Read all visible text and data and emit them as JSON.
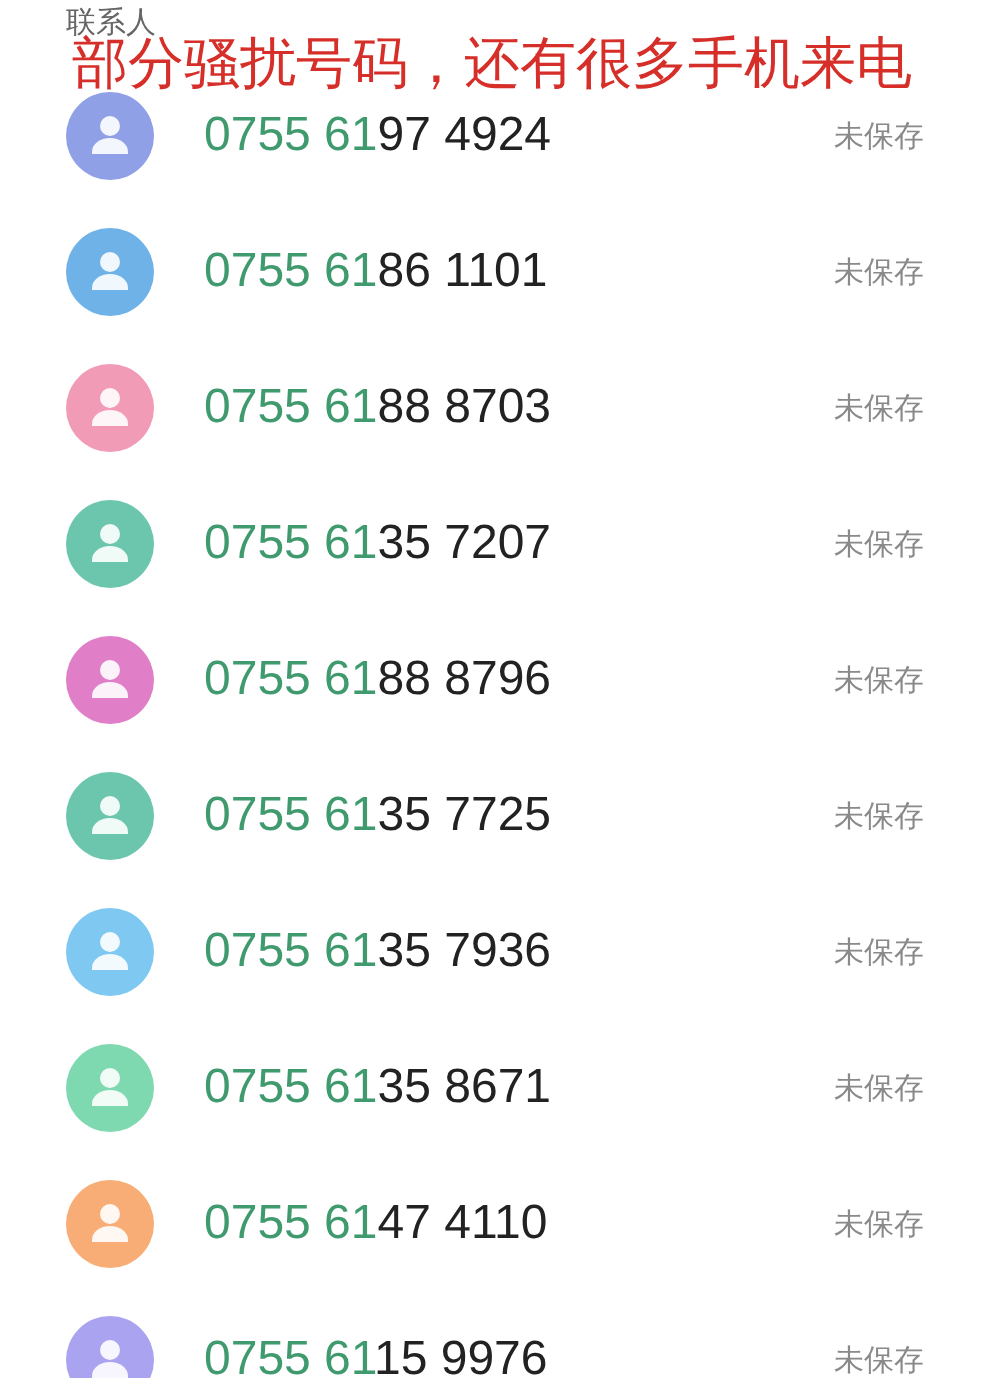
{
  "header": {
    "title": "联系人"
  },
  "caption": "部分骚扰号码，还有很多手机来电",
  "contacts": [
    {
      "match": "0755 61",
      "rest": "97 4924",
      "status": "未保存",
      "color": "#8fa0e6"
    },
    {
      "match": "0755 61",
      "rest": "86 1101",
      "status": "未保存",
      "color": "#6eb2e8"
    },
    {
      "match": "0755 61",
      "rest": "88 8703",
      "status": "未保存",
      "color": "#f29bb6"
    },
    {
      "match": "0755 61",
      "rest": "35 7207",
      "status": "未保存",
      "color": "#6cc6ae"
    },
    {
      "match": "0755 61",
      "rest": "88 8796",
      "status": "未保存",
      "color": "#e07fc8"
    },
    {
      "match": "0755 61",
      "rest": "35 7725",
      "status": "未保存",
      "color": "#6cc6ae"
    },
    {
      "match": "0755 61",
      "rest": "35 7936",
      "status": "未保存",
      "color": "#7ec8f2"
    },
    {
      "match": "0755 61",
      "rest": "35 8671",
      "status": "未保存",
      "color": "#7fd9b0"
    },
    {
      "match": "0755 61",
      "rest": "47 4110",
      "status": "未保存",
      "color": "#f7ad75"
    },
    {
      "match": "0755 61",
      "rest": "15 9976",
      "status": "未保存",
      "color": "#a9a3f0"
    }
  ]
}
